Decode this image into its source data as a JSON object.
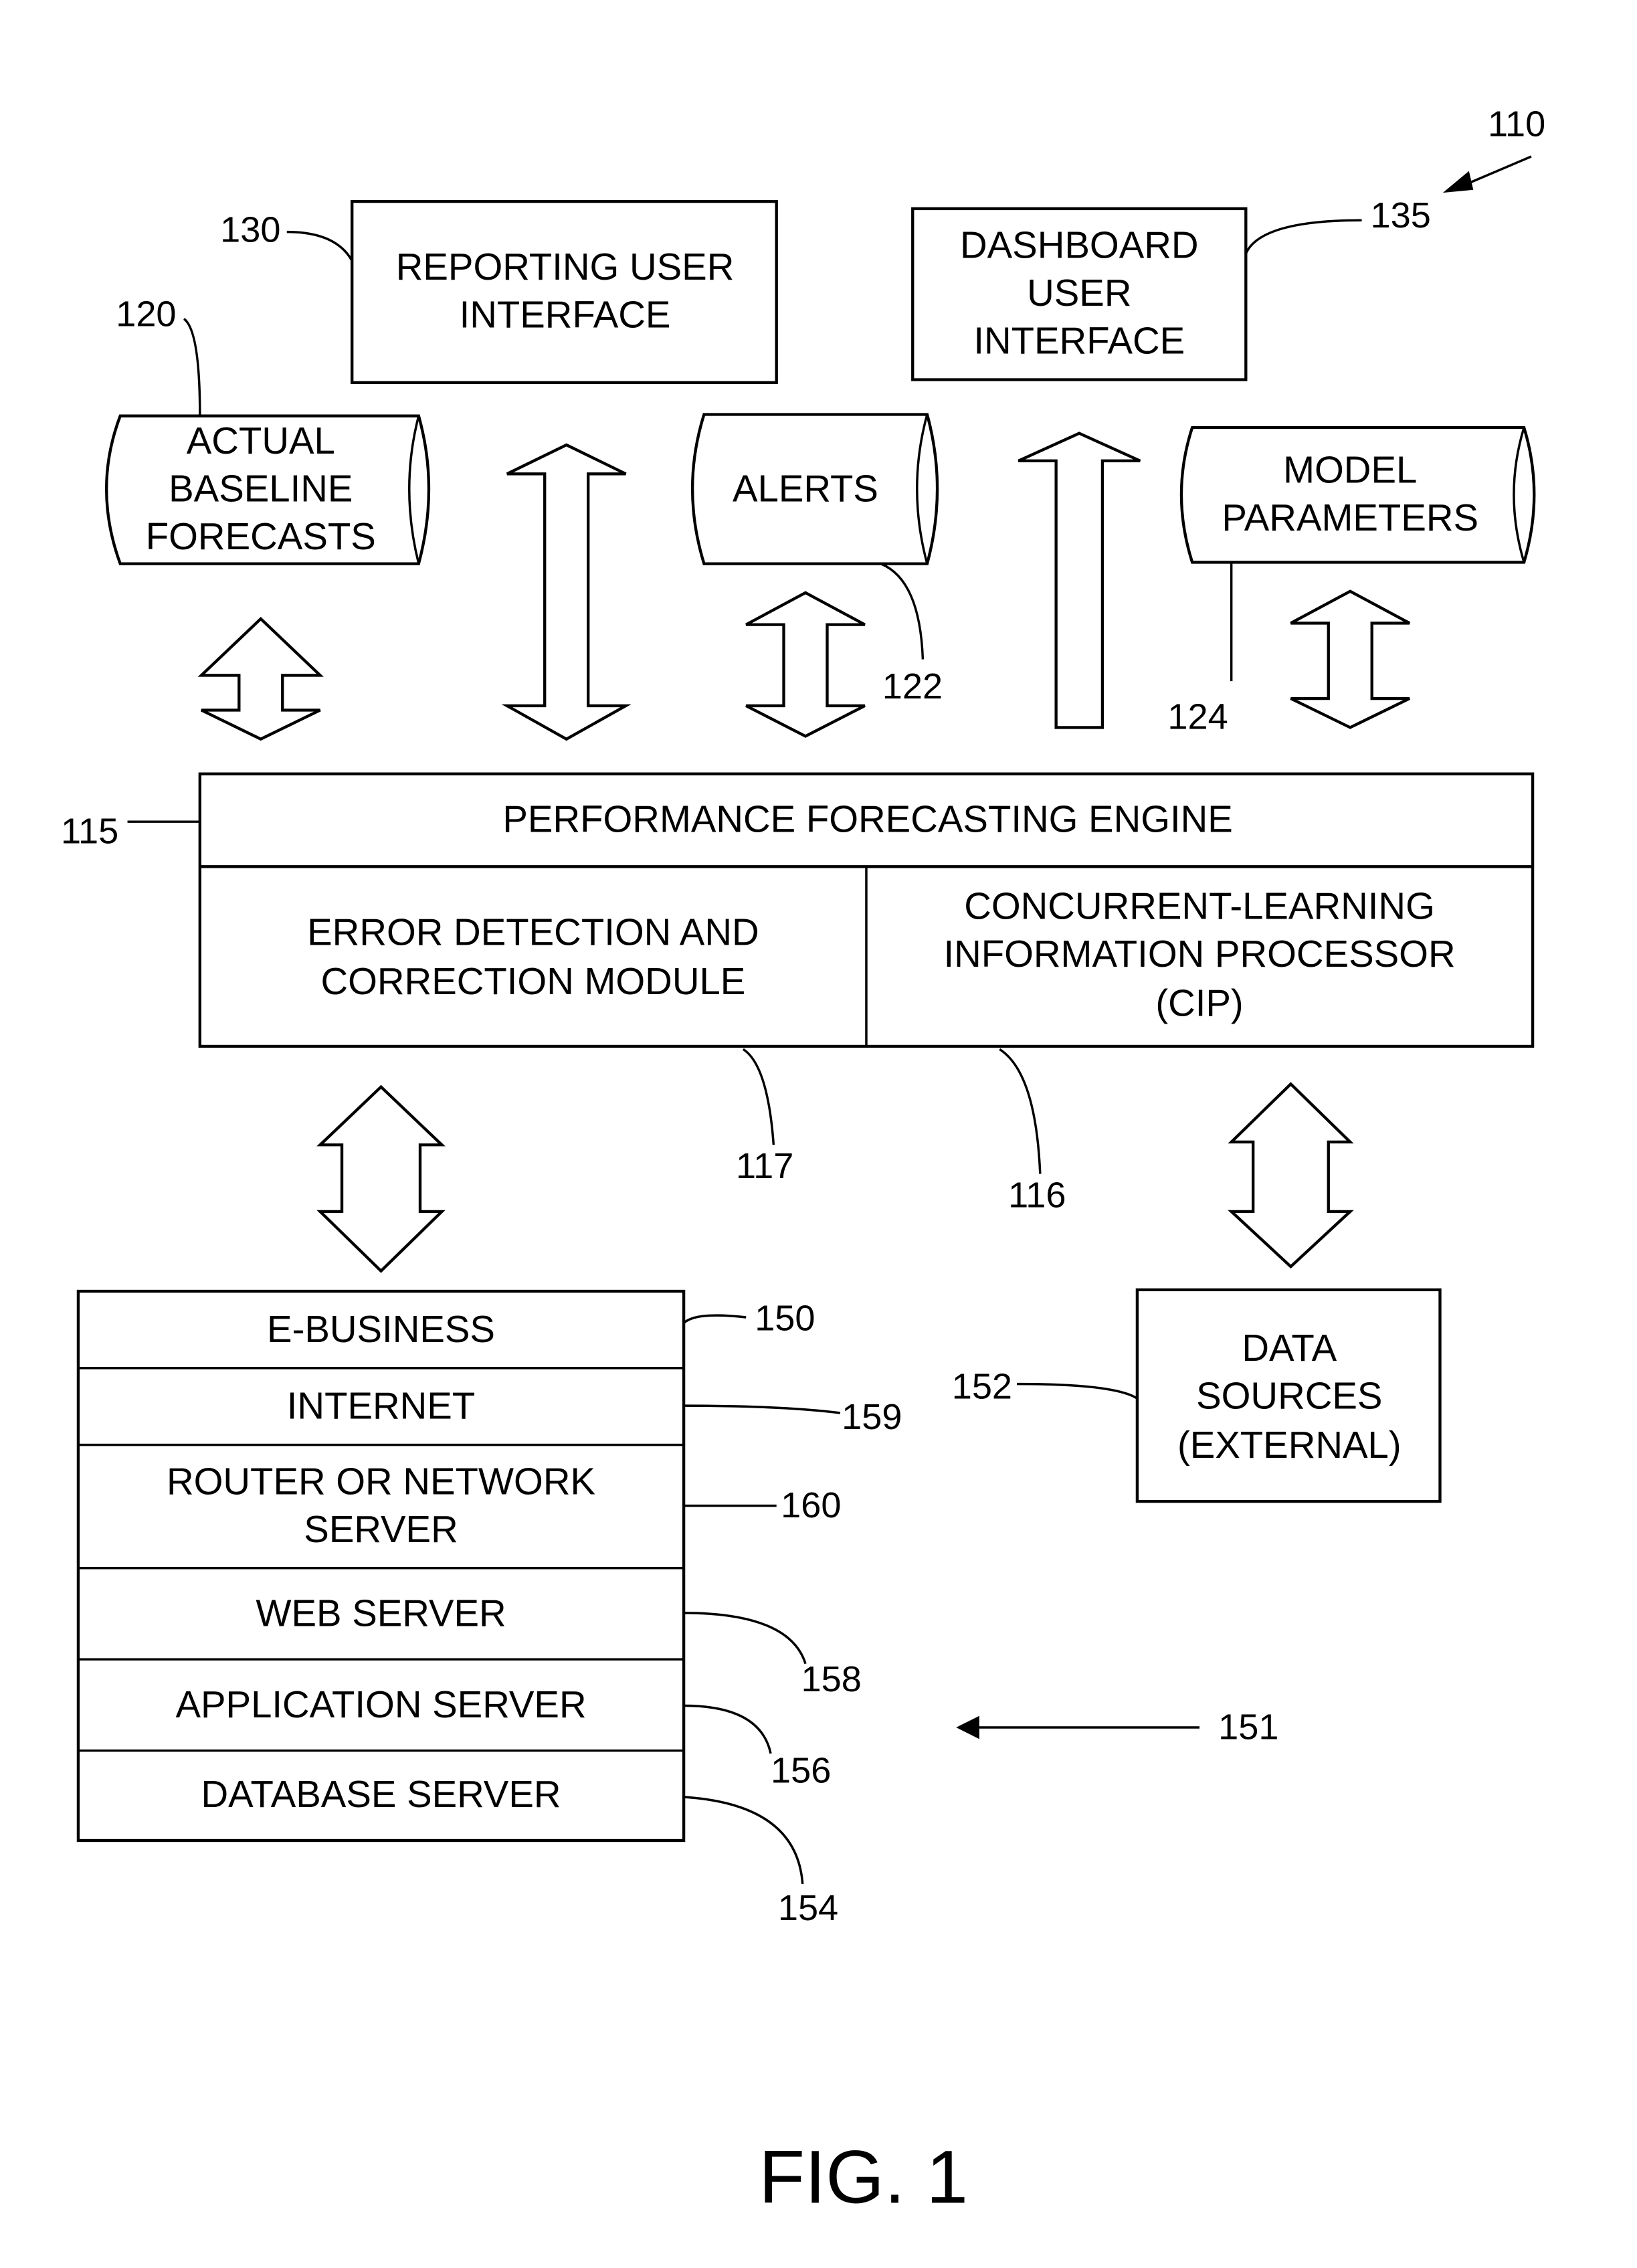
{
  "figure": {
    "caption": "FIG. 1",
    "system_ref": "110"
  },
  "reporting_ui": {
    "ref": "130",
    "lines": [
      "REPORTING USER",
      "INTERFACE"
    ]
  },
  "dashboard_ui": {
    "ref": "135",
    "lines": [
      "DASHBOARD",
      "USER",
      "INTERFACE"
    ]
  },
  "datastores": {
    "forecasts": {
      "ref": "120",
      "lines": [
        "ACTUAL",
        "BASELINE",
        "FORECASTS"
      ]
    },
    "alerts": {
      "ref": "122",
      "lines": [
        "ALERTS"
      ]
    },
    "model_parameters": {
      "ref": "124",
      "lines": [
        "MODEL",
        "PARAMETERS"
      ]
    }
  },
  "engine": {
    "ref": "115",
    "title": "PERFORMANCE FORECASTING ENGINE",
    "error_module": {
      "ref": "117",
      "lines": [
        "ERROR DETECTION AND",
        "CORRECTION MODULE"
      ]
    },
    "cip": {
      "ref": "116",
      "lines": [
        "CONCURRENT-LEARNING",
        "INFORMATION PROCESSOR",
        "(CIP)"
      ]
    }
  },
  "stack": {
    "group_ref": "151",
    "layers": [
      {
        "ref": "150",
        "lines": [
          "E-BUSINESS"
        ]
      },
      {
        "ref": "159",
        "lines": [
          "INTERNET"
        ]
      },
      {
        "ref": "160",
        "lines": [
          "ROUTER OR NETWORK",
          "SERVER"
        ]
      },
      {
        "ref": "158",
        "lines": [
          "WEB SERVER"
        ]
      },
      {
        "ref": "156",
        "lines": [
          "APPLICATION SERVER"
        ]
      },
      {
        "ref": "154",
        "lines": [
          "DATABASE SERVER"
        ]
      }
    ]
  },
  "data_sources": {
    "ref": "152",
    "lines": [
      "DATA",
      "SOURCES",
      "(EXTERNAL)"
    ]
  }
}
